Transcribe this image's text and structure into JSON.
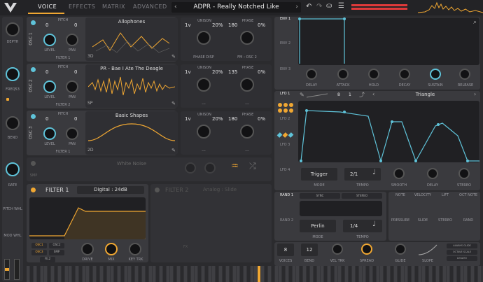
{
  "header": {
    "tabs": [
      "VOICE",
      "EFFECTS",
      "MATRIX",
      "ADVANCED"
    ],
    "preset_name": "ADPR - Really Notched Like"
  },
  "sidebar": {
    "labels": [
      "DEPTH",
      "FREQ53",
      "BEND",
      "RATE",
      "PITCH WHL",
      "MOD WHL"
    ]
  },
  "osc": [
    {
      "name": "OSC 1",
      "wave": "Allophones",
      "dim": "3D",
      "pitch_a": "0",
      "pitch_b": "0",
      "unison": "1v",
      "unison_pct": "20%",
      "phase": "180",
      "phase_pct": "0%",
      "filter": "FILTER 1",
      "bottom": "PHASE DISP",
      "bottom2": "FM ‹ OSC 2"
    },
    {
      "name": "OSC 2",
      "wave": "PR - Bae I Ate The Deagle",
      "dim": "SP",
      "pitch_a": "0",
      "pitch_b": "0",
      "unison": "1v",
      "unison_pct": "20%",
      "phase": "135",
      "phase_pct": "0%",
      "filter": "FILTER 2",
      "bottom": "---",
      "bottom2": "---"
    },
    {
      "name": "OSC 3",
      "wave": "Basic Shapes",
      "dim": "2D",
      "pitch_a": "0",
      "pitch_b": "0",
      "unison": "1v",
      "unison_pct": "20%",
      "phase": "180",
      "phase_pct": "0%",
      "filter": "FILTER 1",
      "bottom": "---",
      "bottom2": "---"
    }
  ],
  "osc_labels": {
    "pitch": "PITCH",
    "level": "LEVEL",
    "pan": "PAN",
    "unison": "UNISON",
    "phase": "PHASE"
  },
  "sample": {
    "name": "SMP",
    "wave": "White Noise"
  },
  "filter1": {
    "title": "FILTER 1",
    "type": "Digital : 24dB",
    "drive": "DRIVE",
    "mix": "MIX",
    "keytrk": "KEY TRK",
    "osc1": "OSC1",
    "osc2": "OSC2",
    "osc3": "OSC3",
    "smp": "SMP",
    "fil2": "FIL2"
  },
  "filter2": {
    "title": "FILTER 2",
    "type": "Analog : Slide",
    "fx": "FX"
  },
  "env": {
    "labels": [
      "ENV 1",
      "ENV 2",
      "ENV 3"
    ],
    "params": [
      "DELAY",
      "ATTACK",
      "HOLD",
      "DECAY",
      "SUSTAIN",
      "RELEASE"
    ]
  },
  "lfo": {
    "labels": [
      "LFO 1",
      "LFO 2",
      "LFO 3",
      "LFO 4"
    ],
    "rate_a": "8",
    "rate_b": "1",
    "shape": "Triangle",
    "mode": "Trigger",
    "mode_lbl": "MODE",
    "tempo": "2/1",
    "tempo_lbl": "TEMPO",
    "smooth": "SMOOTH",
    "delay": "DELAY",
    "stereo": "STEREO"
  },
  "random": {
    "labels": [
      "RAND 1",
      "RAND 2"
    ],
    "sync": "SYNC",
    "stereo": "STEREO",
    "mode": "Perlin",
    "mode_lbl": "MODE",
    "tempo": "1/4",
    "tempo_lbl": "TEMPO"
  },
  "mod_sources": [
    "NOTE",
    "VELOCITY",
    "LIFT",
    "OCT NOTE",
    "PRESSURE",
    "SLIDE",
    "STEREO",
    "RAND"
  ],
  "voice": {
    "voices": "8",
    "voices_lbl": "VOICES",
    "bend": "12",
    "bend_lbl": "BEND",
    "veltrk": "VEL TRK",
    "spread": "SPREAD",
    "glide": "GLIDE",
    "slope": "SLOPE",
    "opts": [
      "ALWAYS GLIDE",
      "OCTAVE SCALE",
      "LEGATO"
    ]
  },
  "colors": {
    "accent": "#f0a732",
    "blue": "#5fc3d9",
    "red": "#e03a3a"
  }
}
